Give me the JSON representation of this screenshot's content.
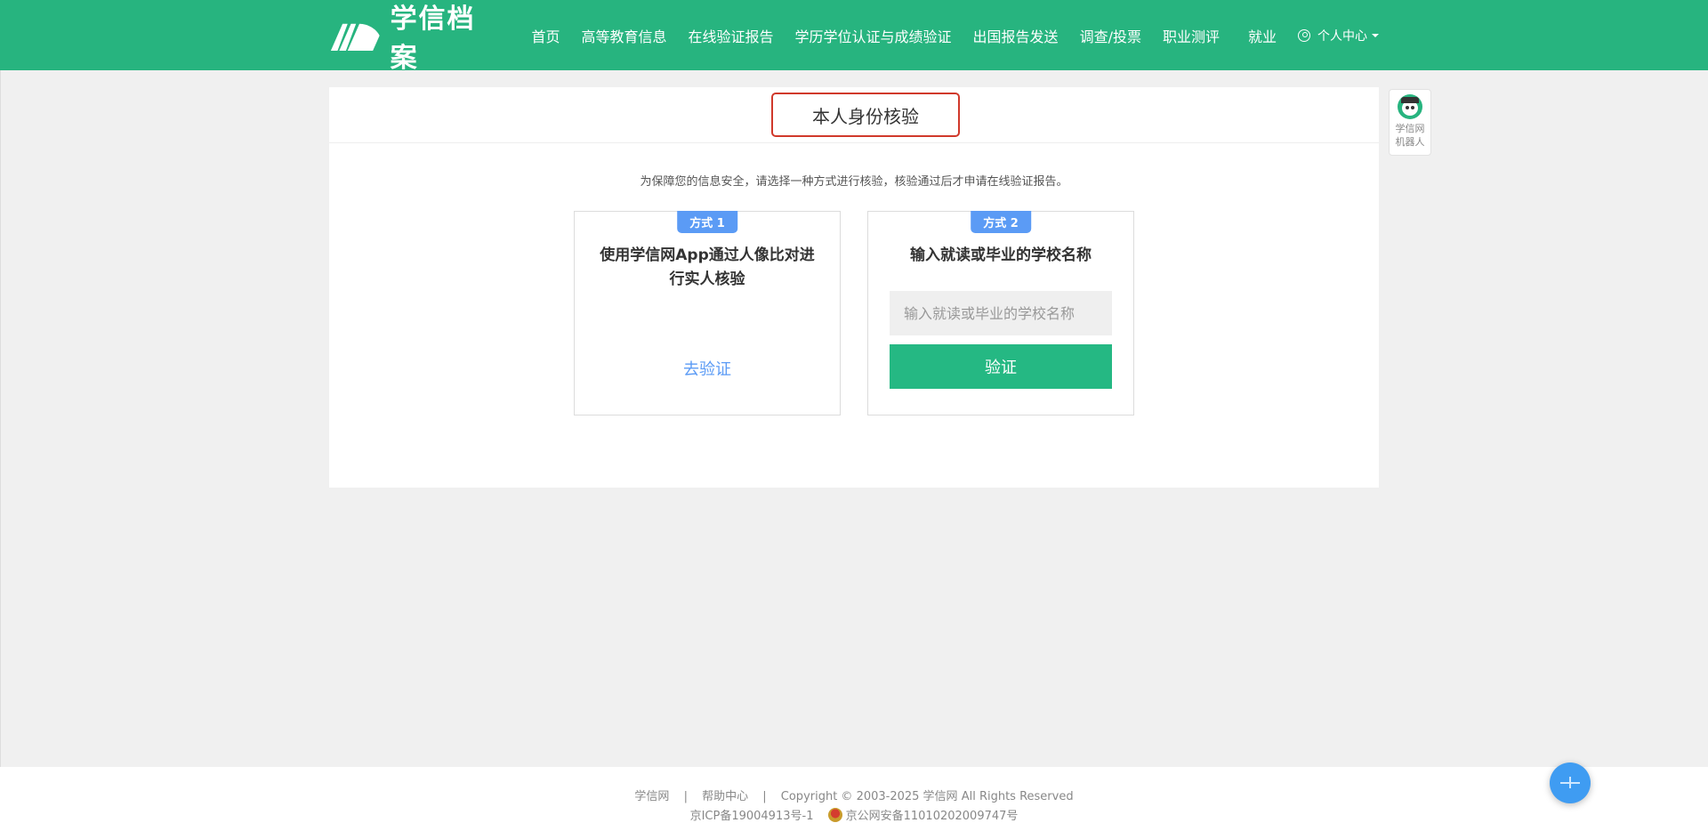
{
  "header": {
    "logo_text": "学信档案",
    "nav": [
      "首页",
      "高等教育信息",
      "在线验证报告",
      "学历学位认证与成绩验证",
      "出国报告发送",
      "调查/投票",
      "职业测评",
      "就业"
    ],
    "user_menu": "个人中心",
    "bg_color": "#27b47f"
  },
  "panel": {
    "title": "本人身份核验",
    "notice": "为保障您的信息安全，请选择一种方式进行核验，核验通过后才申请在线验证报告。",
    "card1": {
      "badge": "方式 1",
      "title": "使用学信网App通过人像比对进行实人核验",
      "link": "去验证"
    },
    "card2": {
      "badge": "方式 2",
      "title": "输入就读或毕业的学校名称",
      "input_placeholder": "输入就读或毕业的学校名称",
      "input_value": "",
      "button": "验证"
    }
  },
  "robot": {
    "line1": "学信网",
    "line2": "机器人"
  },
  "footer": {
    "link1": "学信网",
    "link2": "帮助中心",
    "copyright": "Copyright © 2003-2025 学信网 All Rights Reserved",
    "icp": "京ICP备19004913号-1",
    "police": "京公网安备11010202009747号",
    "separator": "|"
  }
}
